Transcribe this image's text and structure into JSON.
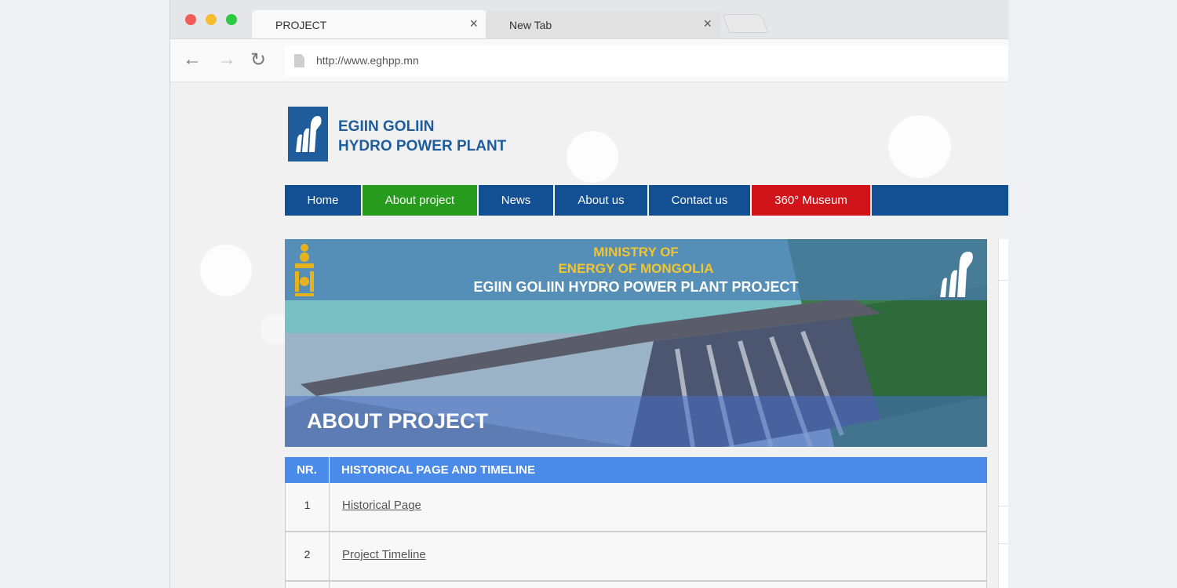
{
  "browser": {
    "tabs": [
      {
        "title": "PROJECT",
        "close": "×"
      },
      {
        "title": "New Tab",
        "close": "×"
      }
    ],
    "nav": {
      "back": "←",
      "forward": "→",
      "reload": "↻"
    },
    "url": "http://www.eghpp.mn"
  },
  "site": {
    "logo_line1": "EGIIN GOLIIN",
    "logo_line2": "HYDRO POWER PLANT",
    "menu": [
      "Home",
      "About project",
      "News",
      "About us",
      "Contact us",
      "360° Museum"
    ],
    "menu_colors": {
      "default": "#134f93",
      "active": "#269b1d",
      "highlight": "#d1141a"
    }
  },
  "hero": {
    "ministry_line1": "MINISTRY OF",
    "ministry_line2": "ENERGY OF MONGOLIA",
    "project_title": "EGIIN GOLIIN HYDRO POWER PLANT PROJECT",
    "section_title": "ABOUT PROJECT"
  },
  "table": {
    "headers": [
      "NR.",
      "HISTORICAL PAGE AND TIMELINE"
    ],
    "rows": [
      {
        "nr": "1",
        "title": "Historical Page"
      },
      {
        "nr": "2",
        "title": "Project Timeline"
      }
    ]
  }
}
